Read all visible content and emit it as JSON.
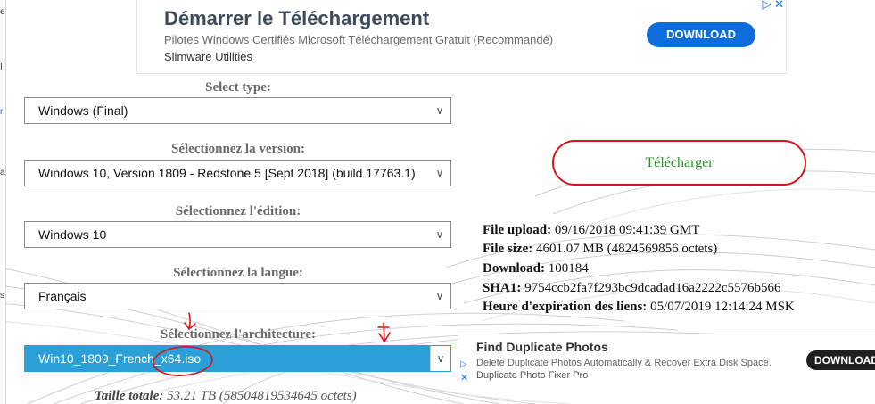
{
  "ad_top": {
    "title": "Démarrer le Téléchargement",
    "subtitle": "Pilotes Windows Certifiés Microsoft Téléchargement Gratuit (Recommandé)",
    "brand": "Slimware Utilities",
    "button": "DOWNLOAD",
    "choices_icon": "adchoices-icon"
  },
  "form": {
    "type_label": "Select type:",
    "type_value": "Windows (Final)",
    "version_label": "Sélectionnez la version:",
    "version_value": "Windows 10, Version 1809 - Redstone 5 [Sept 2018] (build 17763.1)",
    "edition_label": "Sélectionnez l'édition:",
    "edition_value": "Windows 10",
    "language_label": "Sélectionnez la langue:",
    "language_value": "Français",
    "arch_label": "Sélectionnez l'architecture:",
    "arch_value": "Win10_1809_French_x64.iso",
    "total_label": "Taille totale:",
    "total_value": "53.21 TB (58504819534645 octets)"
  },
  "download_button": "Télécharger",
  "file_info": {
    "upload_label": "File upload:",
    "upload_value": "09/16/2018 09:41:39 GMT",
    "size_label": "File size:",
    "size_value": "4601.07 MB (4824569856 octets)",
    "download_label": "Download:",
    "download_value": "100184",
    "sha1_label": "SHA1:",
    "sha1_value": "9754ccb2fa7f293bc9dcadad16a2222c5576b566",
    "expiry_label": "Heure d'expiration des liens:",
    "expiry_value": "05/07/2019 12:14:24 MSK"
  },
  "ad_bottom": {
    "title": "Find Duplicate Photos",
    "subtitle": "Delete Duplicate Photos Automatically & Recover Extra Disk Space.",
    "brand": "Duplicate Photo Fixer Pro",
    "button": "DOWNLOAD"
  },
  "colors": {
    "accent_blue": "#0d6edb",
    "selected_blue": "#2a9fd8",
    "red_annotation": "#d9141c",
    "green_text": "#2e8b2e"
  }
}
